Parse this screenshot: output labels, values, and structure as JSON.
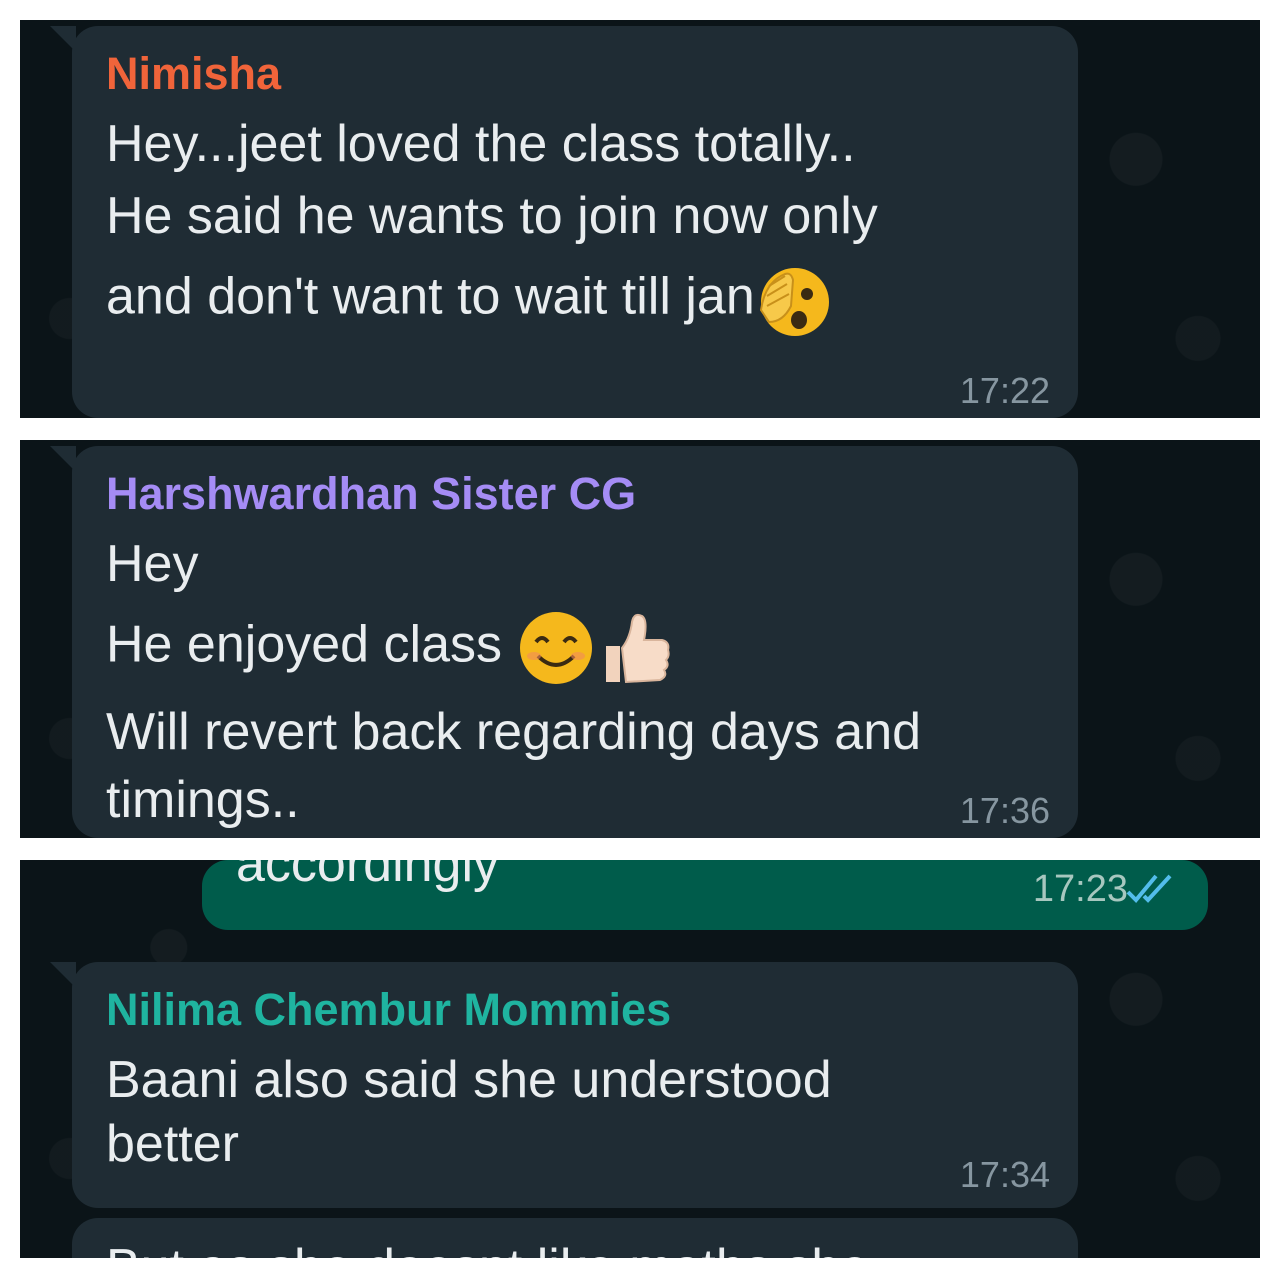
{
  "panels": [
    {
      "sender": "Nimisha",
      "sender_color": "#f0643a",
      "lines": [
        "Hey...jeet loved the class totally..",
        "He said he wants to join now only",
        "and don't want to wait till jan"
      ],
      "emoji": "face-with-hand-over-eye-emoji",
      "time": "17:22"
    },
    {
      "sender": "Harshwardhan Sister CG",
      "sender_color": "#a58cf5",
      "lines": [
        "Hey",
        "He enjoyed class",
        "Will revert back regarding days and",
        "timings.."
      ],
      "emojis": [
        "smiling-face-emoji",
        "thumbs-up-emoji"
      ],
      "time": "17:36"
    },
    {
      "outgoing_text": "accordingly",
      "outgoing_time": "17:23",
      "read_receipt": "double-tick-icon",
      "sender": "Nilima Chembur Mommies",
      "sender_color": "#1fb4a0",
      "lines": [
        "Baani also said she understood",
        "better"
      ],
      "time": "17:34",
      "cut_line": "But as she doesnt like maths she"
    }
  ]
}
